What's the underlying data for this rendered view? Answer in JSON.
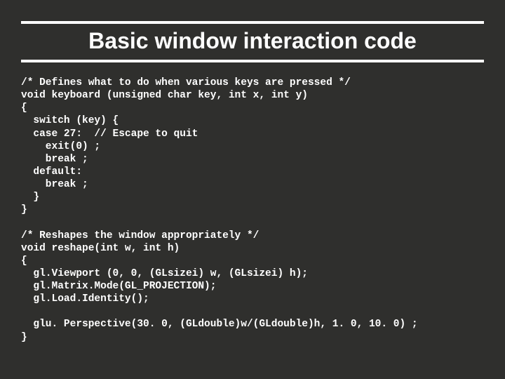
{
  "slide": {
    "title": "Basic window interaction code",
    "code": "/* Defines what to do when various keys are pressed */\nvoid keyboard (unsigned char key, int x, int y)\n{\n  switch (key) {\n  case 27:  // Escape to quit\n    exit(0) ;\n    break ;\n  default:\n    break ;\n  }\n}\n\n/* Reshapes the window appropriately */\nvoid reshape(int w, int h)\n{\n  gl.Viewport (0, 0, (GLsizei) w, (GLsizei) h);\n  gl.Matrix.Mode(GL_PROJECTION);\n  gl.Load.Identity();\n\n  glu. Perspective(30. 0, (GLdouble)w/(GLdouble)h, 1. 0, 10. 0) ;\n}"
  }
}
